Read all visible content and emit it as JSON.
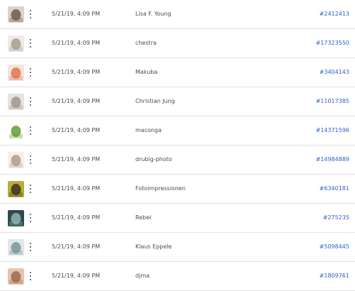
{
  "rows": [
    {
      "date": "5/21/19, 4:09 PM",
      "name": "Lisa F. Young",
      "id": "#2412413",
      "thumb": {
        "bg": "#d9d3cc",
        "fg": "#6e5a4a",
        "icon": "person-portrait-thumbnail"
      }
    },
    {
      "date": "5/21/19, 4:09 PM",
      "name": "chestra",
      "id": "#17323550",
      "thumb": {
        "bg": "#ecebe8",
        "fg": "#a79f8f",
        "icon": "white-object-thumbnail"
      }
    },
    {
      "date": "5/21/19, 4:09 PM",
      "name": "Makuba",
      "id": "#3404143",
      "thumb": {
        "bg": "#f0e5df",
        "fg": "#e2744f",
        "icon": "nose-thumbnail"
      }
    },
    {
      "date": "5/21/19, 4:09 PM",
      "name": "Christian Jung",
      "id": "#11017385",
      "thumb": {
        "bg": "#e7e3df",
        "fg": "#a29688",
        "icon": "garlic-thumbnail"
      }
    },
    {
      "date": "5/21/19, 4:09 PM",
      "name": "maconga",
      "id": "#14371596",
      "thumb": {
        "bg": "#ffffff",
        "fg": "#5c9f34",
        "icon": "green-leaf-thumbnail"
      }
    },
    {
      "date": "5/21/19, 4:09 PM",
      "name": "drubig-photo",
      "id": "#14984889",
      "thumb": {
        "bg": "#f3f1f0",
        "fg": "#b89a8a",
        "icon": "woman-thumbnail"
      }
    },
    {
      "date": "5/21/19, 4:09 PM",
      "name": "Fotoimpressionen",
      "id": "#6340181",
      "thumb": {
        "bg": "#b8ad36",
        "fg": "#3a3320",
        "icon": "woman-in-field-thumbnail"
      }
    },
    {
      "date": "5/21/19, 4:09 PM",
      "name": "Rebel",
      "id": "#275235",
      "thumb": {
        "bg": "#2f4a4e",
        "fg": "#8fb3b6",
        "icon": "dark-scene-thumbnail"
      }
    },
    {
      "date": "5/21/19, 4:09 PM",
      "name": "Klaus Eppele",
      "id": "#5098445",
      "thumb": {
        "bg": "#e2e6e5",
        "fg": "#7b9497",
        "icon": "bottle-thumbnail"
      }
    },
    {
      "date": "5/21/19, 4:09 PM",
      "name": "djma",
      "id": "#1809761",
      "thumb": {
        "bg": "#e8c3ab",
        "fg": "#9b6a52",
        "icon": "face-thumbnail"
      }
    }
  ]
}
